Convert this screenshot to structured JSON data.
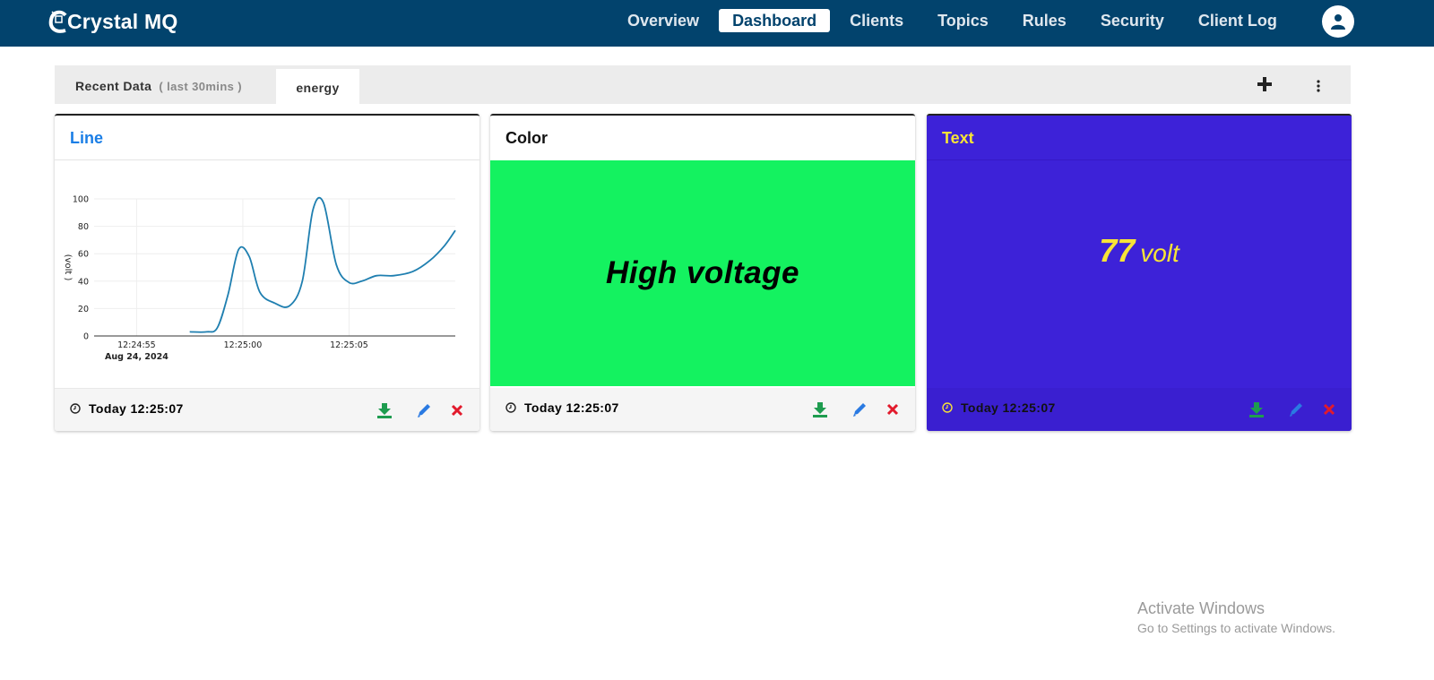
{
  "app": {
    "brand": "Crystal MQ"
  },
  "nav": {
    "items": [
      "Overview",
      "Dashboard",
      "Clients",
      "Topics",
      "Rules",
      "Security",
      "Client Log"
    ],
    "active": "Dashboard"
  },
  "tabs": {
    "recent_label": "Recent Data",
    "recent_sub": "( last 30mins )",
    "active_tab": "energy"
  },
  "cards": [
    {
      "title": "Line",
      "timestamp": "Today 12:25:07"
    },
    {
      "title": "Color",
      "value_text": "High voltage",
      "fill_color": "#14f260",
      "timestamp": "Today 12:25:07"
    },
    {
      "title": "Text",
      "value": "77",
      "unit": "volt",
      "background_color": "#3d22d8",
      "text_color": "#f7e437",
      "timestamp": "Today 12:25:07"
    }
  ],
  "chart_data": {
    "type": "line",
    "ylabel": "(volt )",
    "xlabel": "",
    "ylim": [
      0,
      100
    ],
    "yticks": [
      0,
      20,
      40,
      60,
      80,
      100
    ],
    "xticks": [
      "12:24:55",
      "12:25:00",
      "12:25:05"
    ],
    "xtick_date": "Aug 24, 2024",
    "grid": true,
    "series": [
      {
        "color": "#1f7fb0",
        "points": [
          {
            "t": 57.5,
            "y": 3
          },
          {
            "t": 58.3,
            "y": 3
          },
          {
            "t": 58.8,
            "y": 6
          },
          {
            "t": 59.3,
            "y": 30
          },
          {
            "t": 59.8,
            "y": 63
          },
          {
            "t": 60.3,
            "y": 58
          },
          {
            "t": 60.8,
            "y": 32
          },
          {
            "t": 61.5,
            "y": 24
          },
          {
            "t": 62.2,
            "y": 22
          },
          {
            "t": 62.8,
            "y": 40
          },
          {
            "t": 63.3,
            "y": 92
          },
          {
            "t": 63.8,
            "y": 97
          },
          {
            "t": 64.4,
            "y": 52
          },
          {
            "t": 65.0,
            "y": 39
          },
          {
            "t": 65.6,
            "y": 40
          },
          {
            "t": 66.3,
            "y": 44
          },
          {
            "t": 67.1,
            "y": 44
          },
          {
            "t": 68.0,
            "y": 47
          },
          {
            "t": 68.8,
            "y": 55
          },
          {
            "t": 69.5,
            "y": 66
          },
          {
            "t": 70.0,
            "y": 77
          }
        ]
      }
    ]
  },
  "watermark": {
    "title": "Activate Windows",
    "subtitle": "Go to Settings to activate Windows."
  }
}
